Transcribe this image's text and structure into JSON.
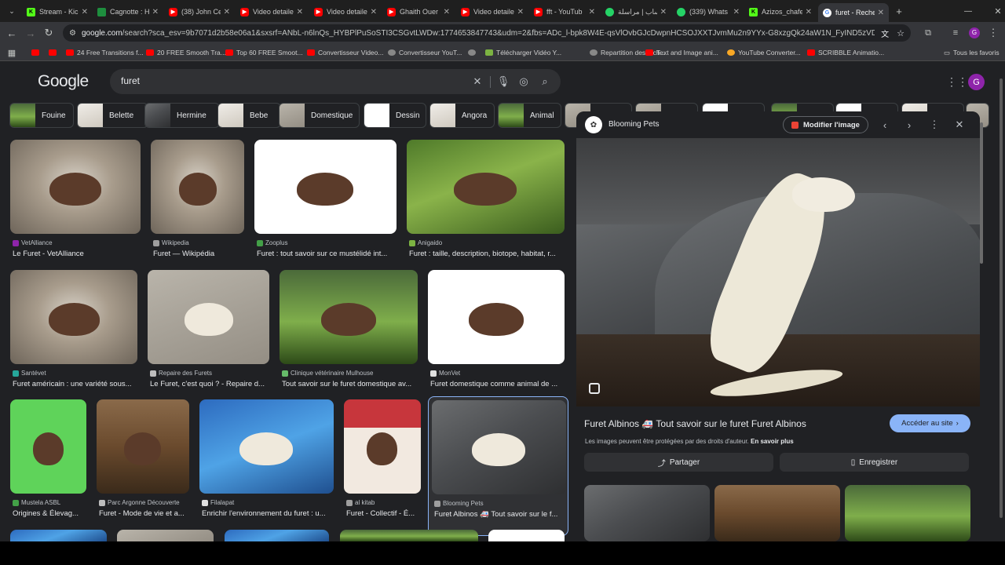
{
  "tabs": [
    {
      "label": "Stream - Kick",
      "fav": "kick",
      "active": false
    },
    {
      "label": "Cagnotte : H",
      "fav": "green",
      "active": false
    },
    {
      "label": "(38) John Ce",
      "fav": "yt",
      "active": false
    },
    {
      "label": "Video detaile",
      "fav": "yt",
      "active": false
    },
    {
      "label": "Video detaile",
      "fav": "yt",
      "active": false
    },
    {
      "label": "Ghaith Ouer",
      "fav": "yt",
      "active": false
    },
    {
      "label": "Video detaile",
      "fav": "yt",
      "active": false
    },
    {
      "label": "fft - YouTub",
      "fav": "yt",
      "active": false
    },
    {
      "label": "واتساب | مراسلة",
      "fav": "wa",
      "active": false
    },
    {
      "label": "(339) Whats",
      "fav": "wa",
      "active": false
    },
    {
      "label": "Azizos_chafe",
      "fav": "kick",
      "active": false
    },
    {
      "label": "furet - Reche",
      "fav": "g",
      "active": true
    }
  ],
  "toolbar": {
    "url_domain": "google.com",
    "url_rest": "/search?sca_esv=9b7071d2b58e06a1&sxsrf=ANbL-n6lnQs_HYBPlPuSoSTI3CSGvtLWDw:1774653847743&udm=2&fbs=ADc_l-bpk8W4E-qsVlOvbGJcDwpnHCSOJXXTJvmMu2n9YYx-G8xzgQk24aW1N_FyIND5zVDd4bb14119C8nZHL5I4..."
  },
  "bookmarks": [
    {
      "label": "",
      "icon": "yt"
    },
    {
      "label": "",
      "icon": "yt"
    },
    {
      "label": "24 Free Transitions f...",
      "icon": "yt"
    },
    {
      "label": "20 FREE Smooth Tra...",
      "icon": "yt"
    },
    {
      "label": "Top 60 FREE Smoot...",
      "icon": "yt"
    },
    {
      "label": "Convertisseur Video...",
      "icon": "yt"
    },
    {
      "label": "Convertisseur YouT...",
      "icon": "gr"
    },
    {
      "label": "",
      "icon": "gr"
    },
    {
      "label": "Télécharger Vidéo Y...",
      "icon": "dl"
    },
    {
      "label": "Repartition des tach...",
      "icon": "gr"
    },
    {
      "label": "Text and Image ani...",
      "icon": "yt"
    },
    {
      "label": "YouTube Converter...",
      "icon": "yc"
    },
    {
      "label": "SCRIBBLE Animatio...",
      "icon": "yt"
    }
  ],
  "all_bookmarks_label": "Tous les favoris",
  "google": {
    "logo": "Google",
    "query": "furet",
    "avatar_letter": "G"
  },
  "chips": [
    {
      "label": "Fouine"
    },
    {
      "label": "Belette"
    },
    {
      "label": "Hermine"
    },
    {
      "label": "Bebe"
    },
    {
      "label": "Domestique"
    },
    {
      "label": "Dessin"
    },
    {
      "label": "Angora"
    },
    {
      "label": "Animal"
    }
  ],
  "results": [
    {
      "source": "VetAlliance",
      "title": "Le Furet - VetAlliance",
      "color": "#8e24aa"
    },
    {
      "source": "Wikipedia",
      "title": "Furet — Wikipédia",
      "color": "#9e9e9e"
    },
    {
      "source": "Zooplus",
      "title": "Furet : tout savoir sur ce mustélidé int...",
      "color": "#43a047"
    },
    {
      "source": "Anigaido",
      "title": "Furet : taille, description, biotope, habitat, r...",
      "color": "#7cb342"
    },
    {
      "source": "Santévet",
      "title": "Furet américain : une variété sous...",
      "color": "#26a69a"
    },
    {
      "source": "Repaire des Furets",
      "title": "Le Furet, c'est quoi ? - Repaire d...",
      "color": "#bdbdbd"
    },
    {
      "source": "Clinique vétérinaire Mulhouse",
      "title": "Tout savoir sur le furet domestique av...",
      "color": "#66bb6a"
    },
    {
      "source": "MonVet",
      "title": "Furet domestique comme animal de ...",
      "color": "#e0e0e0"
    },
    {
      "source": "Mustela ASBL",
      "title": "Origines & Élevag...",
      "color": "#43a047"
    },
    {
      "source": "Parc Argonne Découverte",
      "title": "Furet - Mode de vie et a...",
      "color": "#bdbdbd"
    },
    {
      "source": "Filalapat",
      "title": "Enrichir l'environnement du furet : u...",
      "color": "#e0e0e0"
    },
    {
      "source": "al kitab",
      "title": "Furet - Collectif - É...",
      "color": "#9e9e9e"
    },
    {
      "source": "Blooming Pets",
      "title": "Furet Albinos 🚑 Tout savoir sur le f...",
      "color": "#9e9e9e"
    }
  ],
  "panel": {
    "site": "Blooming Pets",
    "modify_label": "Modifier l'image",
    "title": "Furet Albinos 🚑 Tout savoir sur le furet Furet Albinos",
    "visit_label": "Accéder au site",
    "copyright": "Les images peuvent être protégées par des droits d'auteur.",
    "learn_more": "En savoir plus",
    "share_label": "Partager",
    "save_label": "Enregistrer"
  }
}
